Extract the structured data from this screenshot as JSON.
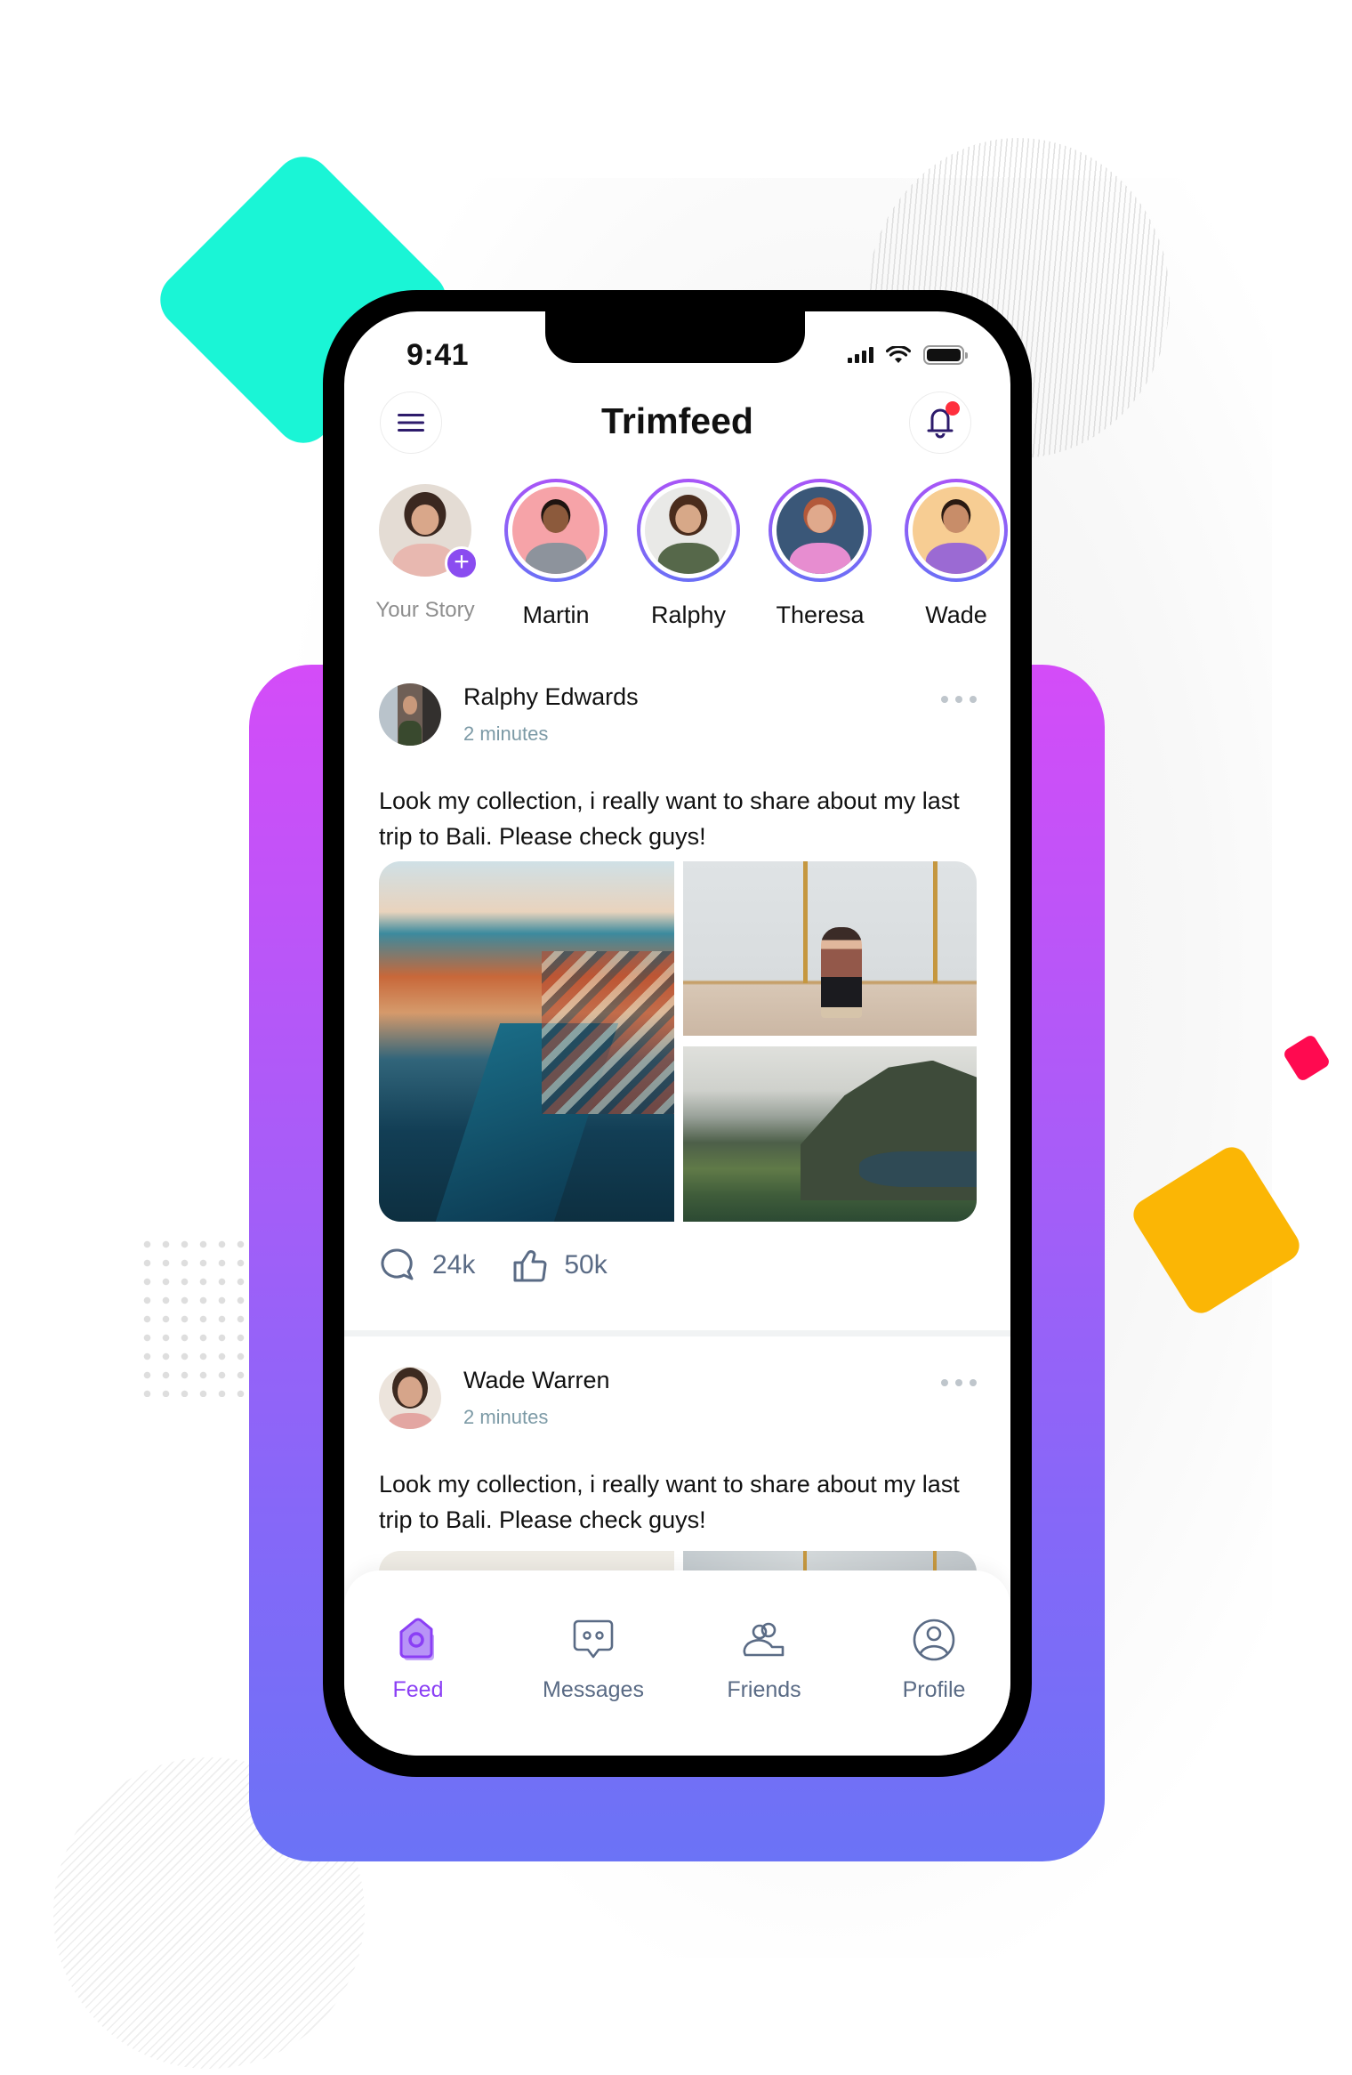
{
  "colors": {
    "accent": "#8b3ff5",
    "story_ring_start": "#a855f7",
    "story_ring_end": "#6b6ff6",
    "notification_dot": "#ff2f3d",
    "panel_gradient_top": "#d44cf8",
    "panel_gradient_bottom": "#6b73f6",
    "teal_shape": "#1af5d6",
    "yellow_shape": "#fbb605",
    "red_shape": "#ff0a50",
    "muted_text": "#7c9aa6",
    "icon_gray": "#5a6b85"
  },
  "status_bar": {
    "time": "9:41",
    "icons": [
      "cellular-signal-icon",
      "wifi-icon",
      "battery-icon"
    ]
  },
  "header": {
    "title": "Trimfeed",
    "menu_icon": "hamburger-menu-icon",
    "notification_icon": "bell-icon",
    "has_unread_notification": true
  },
  "stories": [
    {
      "label": "Your Story",
      "is_own": true,
      "add_icon": "plus-icon"
    },
    {
      "label": "Martin"
    },
    {
      "label": "Ralphy"
    },
    {
      "label": "Theresa"
    },
    {
      "label": "Wade"
    }
  ],
  "posts": [
    {
      "author": "Ralphy Edwards",
      "time": "2 minutes",
      "text": "Look my collection, i really want to share about my last trip to Bali. Please check guys!",
      "comments": "24k",
      "likes": "50k",
      "images": [
        "city-canal-aerial",
        "man-sitting-by-wall",
        "mountain-island-view"
      ]
    },
    {
      "author": "Wade Warren",
      "time": "2 minutes",
      "text": "Look my collection, i really want to share about my last trip to Bali. Please check guys!"
    }
  ],
  "bottom_nav": [
    {
      "label": "Feed",
      "icon": "home-icon",
      "active": true
    },
    {
      "label": "Messages",
      "icon": "chat-bubble-icon",
      "active": false
    },
    {
      "label": "Friends",
      "icon": "users-icon",
      "active": false
    },
    {
      "label": "Profile",
      "icon": "user-circle-icon",
      "active": false
    }
  ]
}
